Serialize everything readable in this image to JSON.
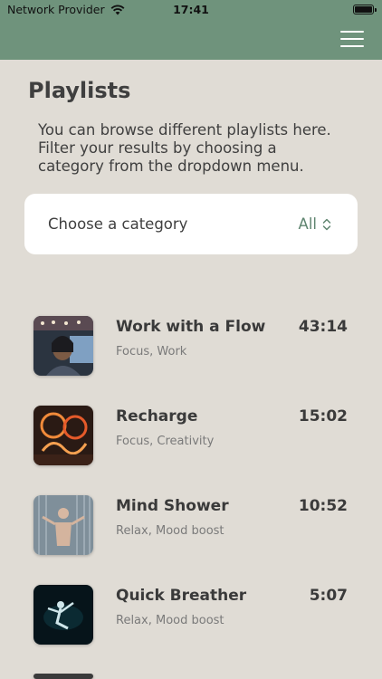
{
  "status_bar": {
    "carrier": "Network Provider",
    "time": "17:41"
  },
  "header": {
    "menu_icon": "hamburger-menu-icon"
  },
  "page": {
    "title": "Playlists",
    "intro": "You can browse different playlists here. Filter your results by choosing a category from the dropdown menu."
  },
  "category": {
    "label": "Choose a category",
    "selected": "All",
    "icon": "chevron-updown-icon"
  },
  "playlists": [
    {
      "title": "Work with a Flow",
      "tags": "Focus, Work",
      "duration": "43:14"
    },
    {
      "title": "Recharge",
      "tags": "Focus, Creativity",
      "duration": "15:02"
    },
    {
      "title": "Mind Shower",
      "tags": "Relax, Mood boost",
      "duration": "10:52"
    },
    {
      "title": "Quick Breather",
      "tags": "Relax, Mood boost",
      "duration": "5:07"
    }
  ],
  "colors": {
    "header": "#6f937c",
    "background": "#e0dcd5",
    "accent": "#5f8570"
  }
}
